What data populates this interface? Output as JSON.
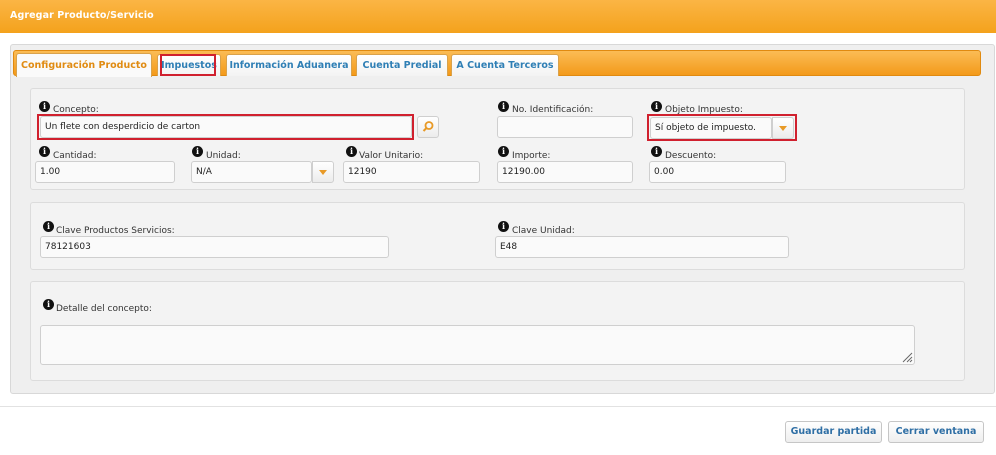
{
  "window": {
    "title": "Agregar Producto/Servicio"
  },
  "tabs": [
    {
      "label": "Configuración Producto"
    },
    {
      "label": "Impuestos"
    },
    {
      "label": "Información Aduanera"
    },
    {
      "label": "Cuenta Predial"
    },
    {
      "label": "A Cuenta Terceros"
    }
  ],
  "fields": {
    "concepto": {
      "label": "Concepto:",
      "value": "Un flete con desperdicio de carton"
    },
    "no_identificacion": {
      "label": "No. Identificación:",
      "value": ""
    },
    "objeto_impuesto": {
      "label": "Objeto Impuesto:",
      "value": "Sí objeto de impuesto."
    },
    "cantidad": {
      "label": "Cantidad:",
      "value": "1.00"
    },
    "unidad": {
      "label": "Unidad:",
      "value": "N/A"
    },
    "valor_unitario": {
      "label": "Valor Unitario:",
      "value": "12190"
    },
    "importe": {
      "label": "Importe:",
      "value": "12190.00"
    },
    "descuento": {
      "label": "Descuento:",
      "value": "0.00"
    },
    "clave_productos": {
      "label": "Clave Productos Servicios:",
      "value": "78121603"
    },
    "clave_unidad": {
      "label": "Clave Unidad:",
      "value": "E48"
    },
    "detalle": {
      "label": "Detalle del concepto:",
      "value": ""
    }
  },
  "buttons": {
    "guardar": "Guardar partida",
    "cerrar": "Cerrar ventana"
  },
  "icons": {
    "info": "info-icon",
    "search": "search-icon",
    "dropdown": "chevron-down-icon",
    "resize": "resize-handle-icon"
  },
  "colors": {
    "accent": "#f4a21c",
    "link": "#2f7fb5",
    "highlight": "#d0202e"
  }
}
